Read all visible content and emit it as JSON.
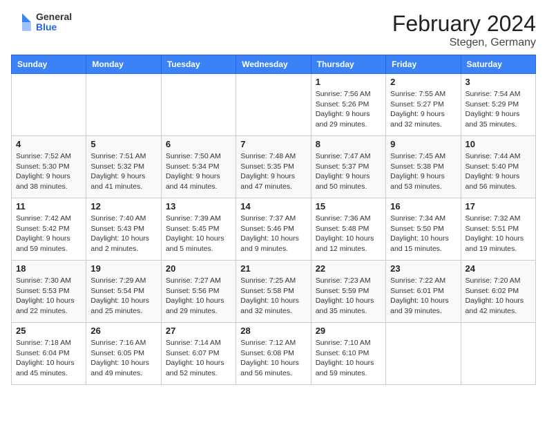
{
  "logo": {
    "general": "General",
    "blue": "Blue"
  },
  "title": "February 2024",
  "subtitle": "Stegen, Germany",
  "days_of_week": [
    "Sunday",
    "Monday",
    "Tuesday",
    "Wednesday",
    "Thursday",
    "Friday",
    "Saturday"
  ],
  "weeks": [
    [
      null,
      null,
      null,
      null,
      {
        "day": "1",
        "sunrise": "Sunrise: 7:56 AM",
        "sunset": "Sunset: 5:26 PM",
        "daylight": "Daylight: 9 hours and 29 minutes."
      },
      {
        "day": "2",
        "sunrise": "Sunrise: 7:55 AM",
        "sunset": "Sunset: 5:27 PM",
        "daylight": "Daylight: 9 hours and 32 minutes."
      },
      {
        "day": "3",
        "sunrise": "Sunrise: 7:54 AM",
        "sunset": "Sunset: 5:29 PM",
        "daylight": "Daylight: 9 hours and 35 minutes."
      }
    ],
    [
      {
        "day": "4",
        "sunrise": "Sunrise: 7:52 AM",
        "sunset": "Sunset: 5:30 PM",
        "daylight": "Daylight: 9 hours and 38 minutes."
      },
      {
        "day": "5",
        "sunrise": "Sunrise: 7:51 AM",
        "sunset": "Sunset: 5:32 PM",
        "daylight": "Daylight: 9 hours and 41 minutes."
      },
      {
        "day": "6",
        "sunrise": "Sunrise: 7:50 AM",
        "sunset": "Sunset: 5:34 PM",
        "daylight": "Daylight: 9 hours and 44 minutes."
      },
      {
        "day": "7",
        "sunrise": "Sunrise: 7:48 AM",
        "sunset": "Sunset: 5:35 PM",
        "daylight": "Daylight: 9 hours and 47 minutes."
      },
      {
        "day": "8",
        "sunrise": "Sunrise: 7:47 AM",
        "sunset": "Sunset: 5:37 PM",
        "daylight": "Daylight: 9 hours and 50 minutes."
      },
      {
        "day": "9",
        "sunrise": "Sunrise: 7:45 AM",
        "sunset": "Sunset: 5:38 PM",
        "daylight": "Daylight: 9 hours and 53 minutes."
      },
      {
        "day": "10",
        "sunrise": "Sunrise: 7:44 AM",
        "sunset": "Sunset: 5:40 PM",
        "daylight": "Daylight: 9 hours and 56 minutes."
      }
    ],
    [
      {
        "day": "11",
        "sunrise": "Sunrise: 7:42 AM",
        "sunset": "Sunset: 5:42 PM",
        "daylight": "Daylight: 9 hours and 59 minutes."
      },
      {
        "day": "12",
        "sunrise": "Sunrise: 7:40 AM",
        "sunset": "Sunset: 5:43 PM",
        "daylight": "Daylight: 10 hours and 2 minutes."
      },
      {
        "day": "13",
        "sunrise": "Sunrise: 7:39 AM",
        "sunset": "Sunset: 5:45 PM",
        "daylight": "Daylight: 10 hours and 5 minutes."
      },
      {
        "day": "14",
        "sunrise": "Sunrise: 7:37 AM",
        "sunset": "Sunset: 5:46 PM",
        "daylight": "Daylight: 10 hours and 9 minutes."
      },
      {
        "day": "15",
        "sunrise": "Sunrise: 7:36 AM",
        "sunset": "Sunset: 5:48 PM",
        "daylight": "Daylight: 10 hours and 12 minutes."
      },
      {
        "day": "16",
        "sunrise": "Sunrise: 7:34 AM",
        "sunset": "Sunset: 5:50 PM",
        "daylight": "Daylight: 10 hours and 15 minutes."
      },
      {
        "day": "17",
        "sunrise": "Sunrise: 7:32 AM",
        "sunset": "Sunset: 5:51 PM",
        "daylight": "Daylight: 10 hours and 19 minutes."
      }
    ],
    [
      {
        "day": "18",
        "sunrise": "Sunrise: 7:30 AM",
        "sunset": "Sunset: 5:53 PM",
        "daylight": "Daylight: 10 hours and 22 minutes."
      },
      {
        "day": "19",
        "sunrise": "Sunrise: 7:29 AM",
        "sunset": "Sunset: 5:54 PM",
        "daylight": "Daylight: 10 hours and 25 minutes."
      },
      {
        "day": "20",
        "sunrise": "Sunrise: 7:27 AM",
        "sunset": "Sunset: 5:56 PM",
        "daylight": "Daylight: 10 hours and 29 minutes."
      },
      {
        "day": "21",
        "sunrise": "Sunrise: 7:25 AM",
        "sunset": "Sunset: 5:58 PM",
        "daylight": "Daylight: 10 hours and 32 minutes."
      },
      {
        "day": "22",
        "sunrise": "Sunrise: 7:23 AM",
        "sunset": "Sunset: 5:59 PM",
        "daylight": "Daylight: 10 hours and 35 minutes."
      },
      {
        "day": "23",
        "sunrise": "Sunrise: 7:22 AM",
        "sunset": "Sunset: 6:01 PM",
        "daylight": "Daylight: 10 hours and 39 minutes."
      },
      {
        "day": "24",
        "sunrise": "Sunrise: 7:20 AM",
        "sunset": "Sunset: 6:02 PM",
        "daylight": "Daylight: 10 hours and 42 minutes."
      }
    ],
    [
      {
        "day": "25",
        "sunrise": "Sunrise: 7:18 AM",
        "sunset": "Sunset: 6:04 PM",
        "daylight": "Daylight: 10 hours and 45 minutes."
      },
      {
        "day": "26",
        "sunrise": "Sunrise: 7:16 AM",
        "sunset": "Sunset: 6:05 PM",
        "daylight": "Daylight: 10 hours and 49 minutes."
      },
      {
        "day": "27",
        "sunrise": "Sunrise: 7:14 AM",
        "sunset": "Sunset: 6:07 PM",
        "daylight": "Daylight: 10 hours and 52 minutes."
      },
      {
        "day": "28",
        "sunrise": "Sunrise: 7:12 AM",
        "sunset": "Sunset: 6:08 PM",
        "daylight": "Daylight: 10 hours and 56 minutes."
      },
      {
        "day": "29",
        "sunrise": "Sunrise: 7:10 AM",
        "sunset": "Sunset: 6:10 PM",
        "daylight": "Daylight: 10 hours and 59 minutes."
      },
      null,
      null
    ]
  ]
}
